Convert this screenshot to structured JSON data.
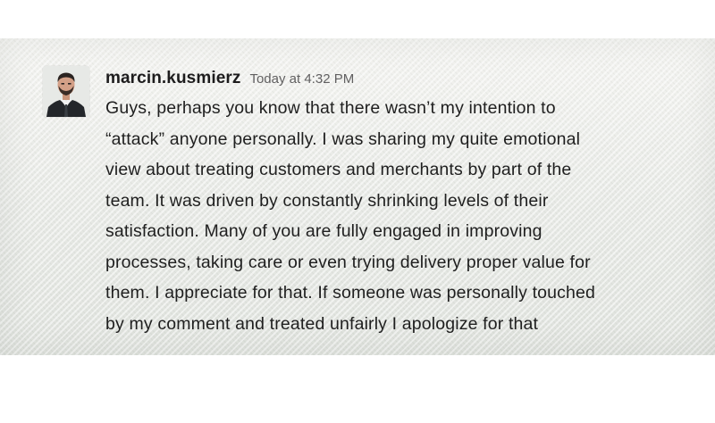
{
  "message": {
    "author": "marcin.kusmierz",
    "timestamp": "Today at 4:32 PM",
    "avatar_icon": "user-avatar-photo",
    "lines": [
      "Guys, perhaps you know that there wasn’t my intention to",
      "“attack” anyone personally. I was sharing my quite emotional",
      "view about treating customers and merchants by part of the",
      "team. It was driven by constantly shrinking levels of their",
      "satisfaction. Many of you are fully engaged in improving",
      "processes, taking care or even trying delivery proper value for",
      "them. I appreciate for that. If someone was personally touched",
      "by my comment and treated unfairly I apologize for that"
    ]
  },
  "colors": {
    "author_text": "#1d1c1d",
    "timestamp_text": "#616061",
    "body_text": "#1f1f1f",
    "background": "#ecedea"
  }
}
